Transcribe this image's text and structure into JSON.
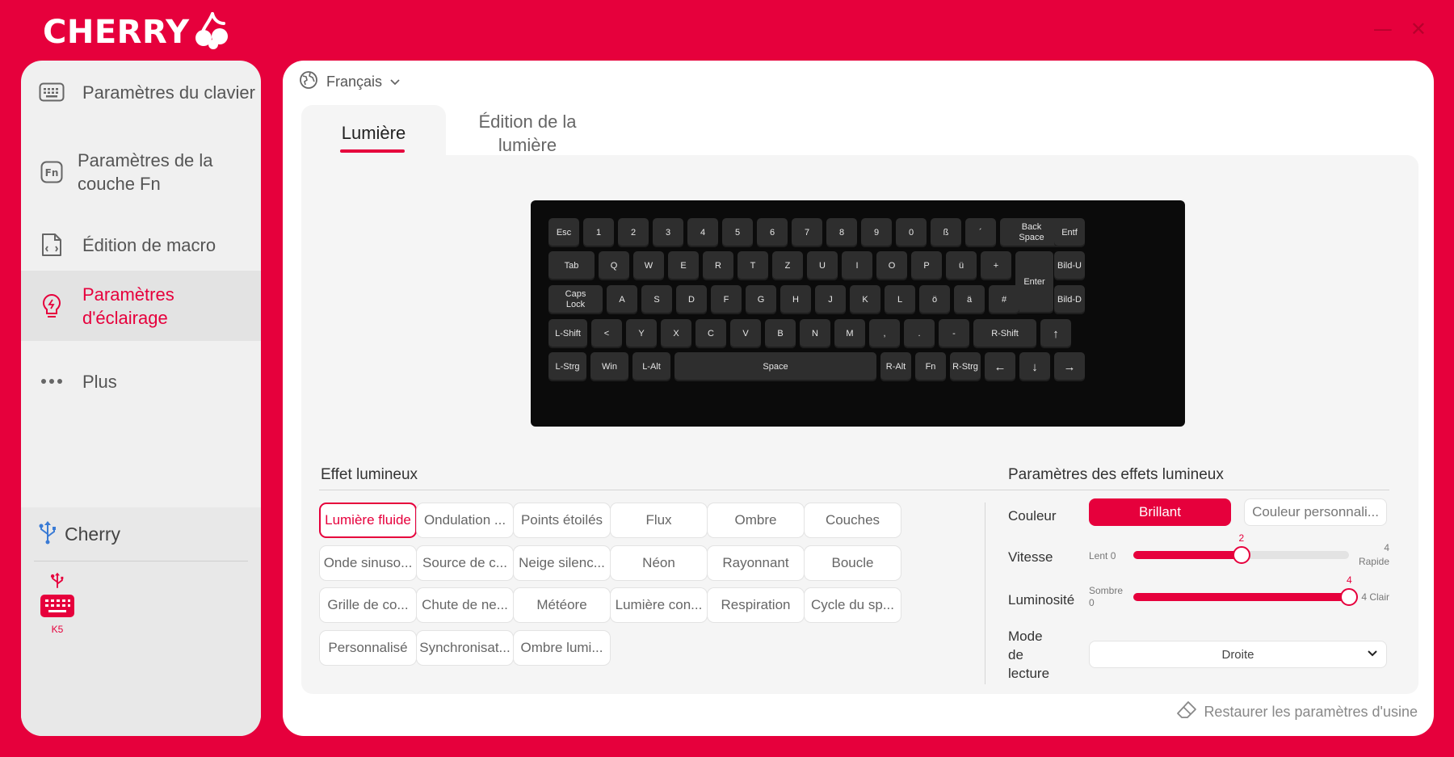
{
  "app": {
    "brand": "CHERRY"
  },
  "window_controls": {
    "minimize": "—",
    "close": "✕"
  },
  "sidebar": {
    "items": [
      {
        "label": "Paramètres du clavier",
        "icon": "keyboard-icon"
      },
      {
        "label": "Paramètres de la couche Fn",
        "icon": "fn-icon"
      },
      {
        "label": "Édition de macro",
        "icon": "macro-file-icon"
      },
      {
        "label": "Paramètres d'éclairage",
        "icon": "lightbulb-icon",
        "active": true
      },
      {
        "label": "Plus",
        "icon": "more-dots-icon"
      }
    ],
    "device_group": {
      "name": "Cherry",
      "device_label": "K5"
    }
  },
  "main": {
    "language": "Français",
    "tabs": [
      {
        "label": "Lumière",
        "active": true
      },
      {
        "label": "Édition de la lumière",
        "active": false
      }
    ],
    "keyboard": {
      "rows": [
        [
          "Esc",
          "1",
          "2",
          "3",
          "4",
          "5",
          "6",
          "7",
          "8",
          "9",
          "0",
          "ß",
          "´",
          "Back Space",
          "Entf"
        ],
        [
          "Tab",
          "Q",
          "W",
          "E",
          "R",
          "T",
          "Z",
          "U",
          "I",
          "O",
          "P",
          "ü",
          "+",
          "Enter",
          "Bild-U"
        ],
        [
          "Caps Lock",
          "A",
          "S",
          "D",
          "F",
          "G",
          "H",
          "J",
          "K",
          "L",
          "ö",
          "ä",
          "#",
          "Bild-D"
        ],
        [
          "L-Shift",
          "<",
          "Y",
          "X",
          "C",
          "V",
          "B",
          "N",
          "M",
          ",",
          ".",
          "-",
          "R-Shift",
          "↑"
        ],
        [
          "L-Strg",
          "Win",
          "L-Alt",
          "Space",
          "R-Alt",
          "Fn",
          "R-Strg",
          "←",
          "↓",
          "→"
        ]
      ]
    },
    "effects": {
      "title": "Effet lumineux",
      "items": [
        "Lumière fluide",
        "Ondulation ...",
        "Points étoilés",
        "Flux",
        "Ombre",
        "Couches",
        "Onde sinuso...",
        "Source de c...",
        "Neige silenc...",
        "Néon",
        "Rayonnant",
        "Boucle",
        "Grille de co...",
        "Chute de ne...",
        "Météore",
        "Lumière con...",
        "Respiration",
        "Cycle du sp...",
        "Personnalisé",
        "Synchronisat...",
        "Ombre lumi..."
      ],
      "selected": "Lumière fluide"
    },
    "params": {
      "title": "Paramètres des effets lumineux",
      "color": {
        "label": "Couleur",
        "options": [
          "Brillant",
          "Couleur personnali..."
        ],
        "selected": "Brillant"
      },
      "speed": {
        "label": "Vitesse",
        "min_label": "Lent 0",
        "max_num": "4",
        "max_word": "Rapide",
        "value": 2,
        "value_label": "2",
        "max": 4
      },
      "brightness": {
        "label": "Luminosité",
        "min_word": "Sombre",
        "min_num": "0",
        "max_label": "4 Clair",
        "value": 4,
        "value_label": "4",
        "max": 4
      },
      "mode": {
        "label_lines": [
          "Mode",
          "de",
          "lecture"
        ],
        "value": "Droite"
      }
    },
    "restore_label": "Restaurer les paramètres d'usine"
  },
  "colors": {
    "accent": "#e6003c",
    "panel": "#ffffff",
    "content_bg": "#f5f5f5",
    "key": "#2e2e2e",
    "keyboard": "#0b0b0b"
  }
}
